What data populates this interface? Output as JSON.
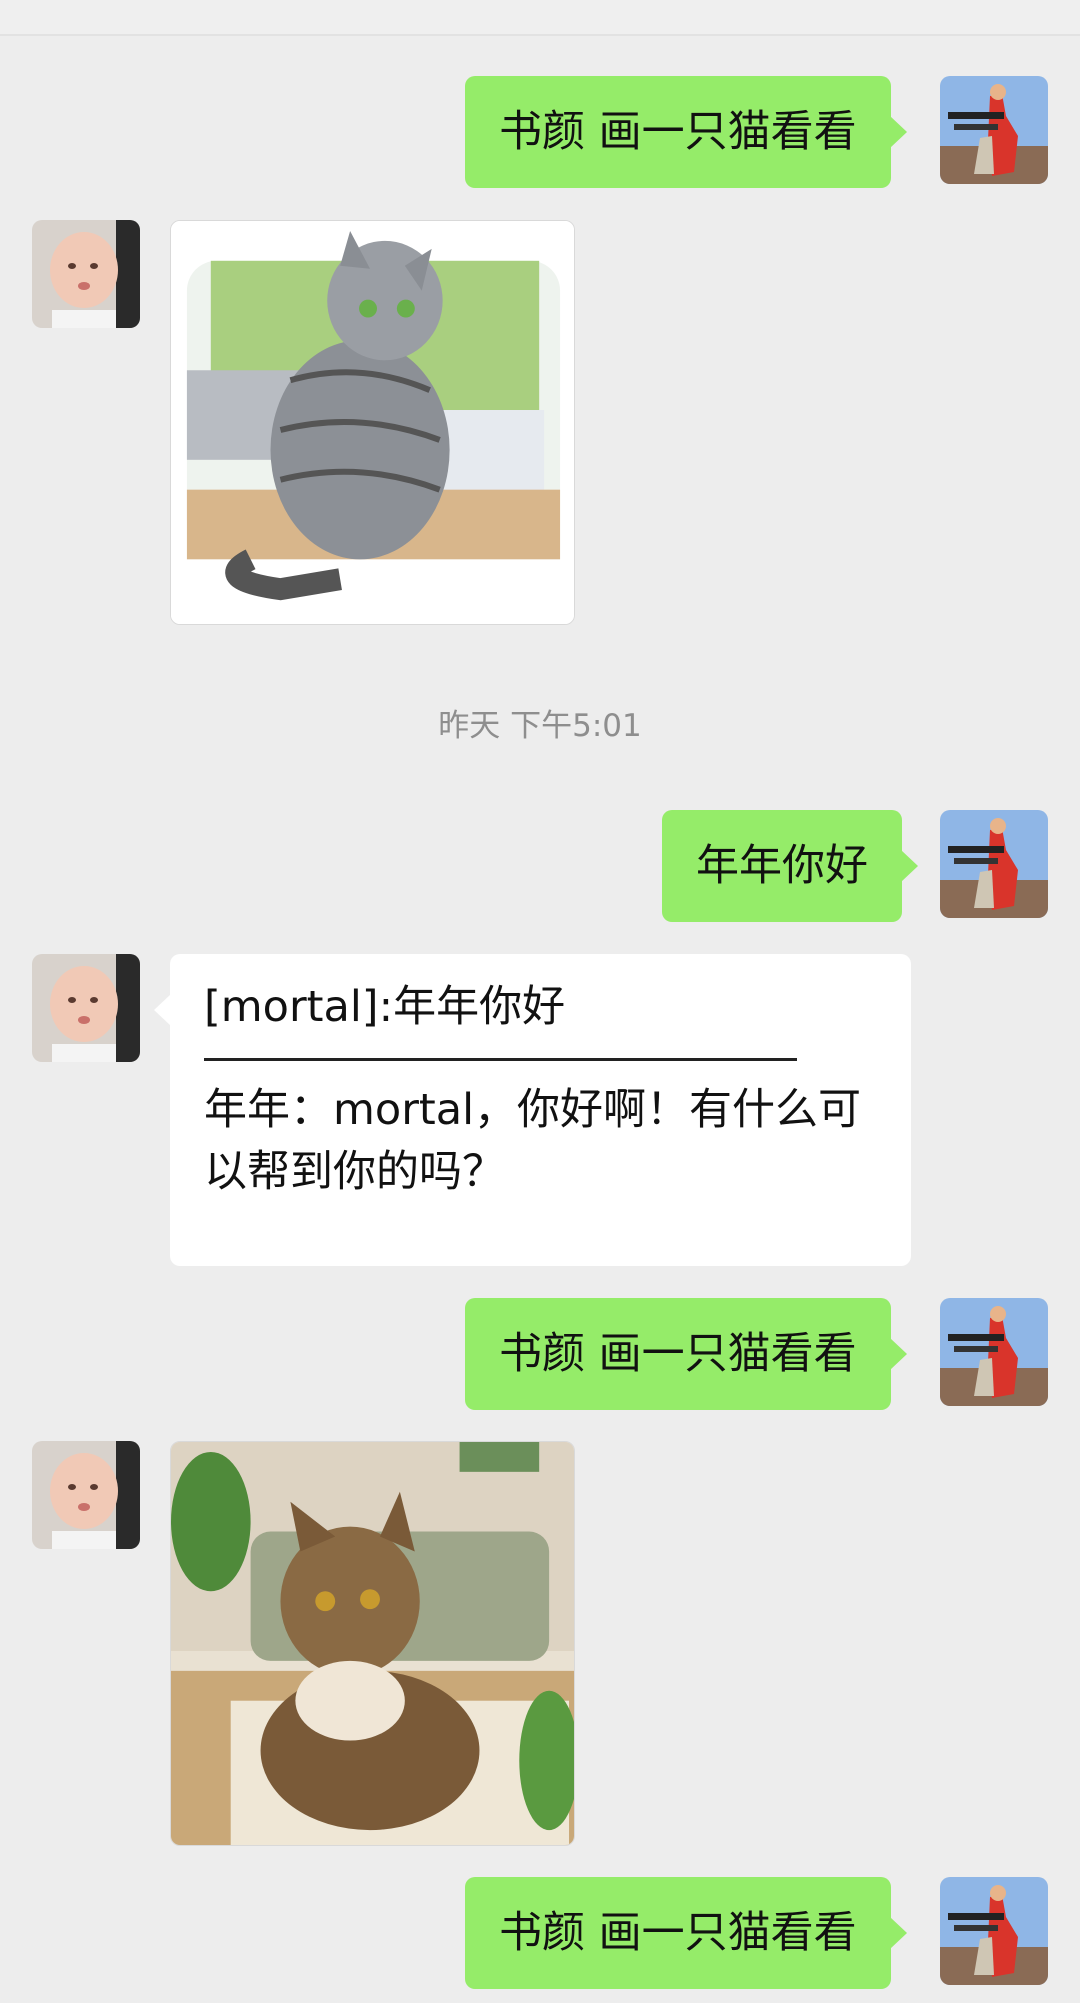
{
  "timestamp": "昨天 下午5:01",
  "messages": {
    "m1": "书颜 画一只猫看看",
    "m3": "年年你好",
    "m4_line1": "[mortal]:年年你好",
    "m4_line2": "年年：mortal，你好啊！有什么可",
    "m4_line3": "以帮到你的吗？",
    "m5": "书颜 画一只猫看看",
    "m7": "书颜 画一只猫看看"
  },
  "colors": {
    "chat_bg": "#ededed",
    "outgoing_bubble": "#95ec69",
    "incoming_bubble": "#ffffff"
  },
  "icons": {
    "self_avatar": "soldier-avatar",
    "bot_avatar": "baby-avatar",
    "image_1": "gray-tabby-cat-image",
    "image_2": "brown-tabby-cat-image"
  }
}
